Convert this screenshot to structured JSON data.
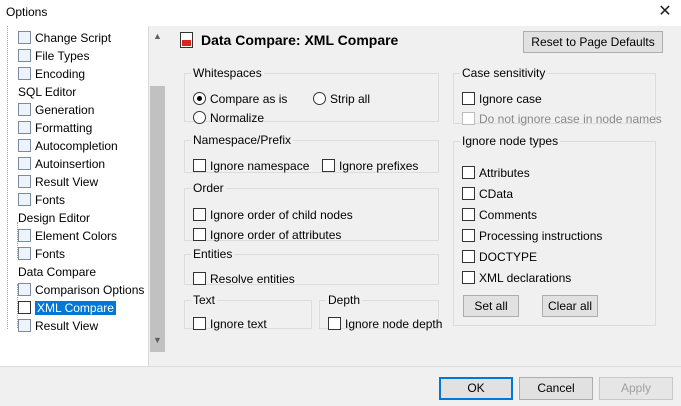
{
  "window": {
    "title": "Options",
    "close_glyph": "✕"
  },
  "tree": {
    "items": [
      {
        "label": "Change Script",
        "icon": "script-icon"
      },
      {
        "label": "File Types",
        "icon": "file-types-icon"
      },
      {
        "label": "Encoding",
        "icon": "encoding-icon"
      },
      {
        "label": "SQL Editor",
        "icon": ""
      },
      {
        "label": "Generation",
        "icon": "generation-icon"
      },
      {
        "label": "Formatting",
        "icon": "formatting-icon"
      },
      {
        "label": "Autocompletion",
        "icon": "autocompletion-icon"
      },
      {
        "label": "Autoinsertion",
        "icon": "autoinsertion-icon"
      },
      {
        "label": "Result View",
        "icon": "grid-icon"
      },
      {
        "label": "Fonts",
        "icon": "font-icon"
      },
      {
        "label": "Design Editor",
        "icon": ""
      },
      {
        "label": "Element Colors",
        "icon": "palette-icon"
      },
      {
        "label": "Fonts",
        "icon": "font-icon"
      },
      {
        "label": "Data Compare",
        "icon": ""
      },
      {
        "label": "Comparison Options",
        "icon": "comparison-icon"
      },
      {
        "label": "XML Compare",
        "icon": "xml-compare-icon",
        "selected": true
      },
      {
        "label": "Result View",
        "icon": "grid-icon"
      }
    ]
  },
  "page": {
    "title": "Data Compare: XML Compare",
    "reset_label": "Reset to Page Defaults"
  },
  "whitespaces": {
    "legend": "Whitespaces",
    "compare_as_is": "Compare as is",
    "strip_all": "Strip all",
    "normalize": "Normalize",
    "selected": "compare_as_is"
  },
  "namespace": {
    "legend": "Namespace/Prefix",
    "ignore_namespace": "Ignore namespace",
    "ignore_prefixes": "Ignore prefixes"
  },
  "order": {
    "legend": "Order",
    "ignore_child_nodes": "Ignore order of child nodes",
    "ignore_attributes": "Ignore order of attributes"
  },
  "entities": {
    "legend": "Entities",
    "resolve": "Resolve entities"
  },
  "text": {
    "legend": "Text",
    "ignore_text": "Ignore text"
  },
  "depth": {
    "legend": "Depth",
    "ignore_node_depth": "Ignore node depth"
  },
  "case": {
    "legend": "Case sensitivity",
    "ignore_case": "Ignore case",
    "do_not_ignore_node_names": "Do not ignore case in node names"
  },
  "node_types": {
    "legend": "Ignore node types",
    "items": [
      "Attributes",
      "CData",
      "Comments",
      "Processing instructions",
      "DOCTYPE",
      "XML declarations"
    ],
    "set_all": "Set all",
    "clear_all": "Clear all"
  },
  "footer": {
    "ok": "OK",
    "cancel": "Cancel",
    "apply": "Apply"
  },
  "colors": {
    "selection": "#0078d7",
    "header_icon_red": "#e02020"
  }
}
